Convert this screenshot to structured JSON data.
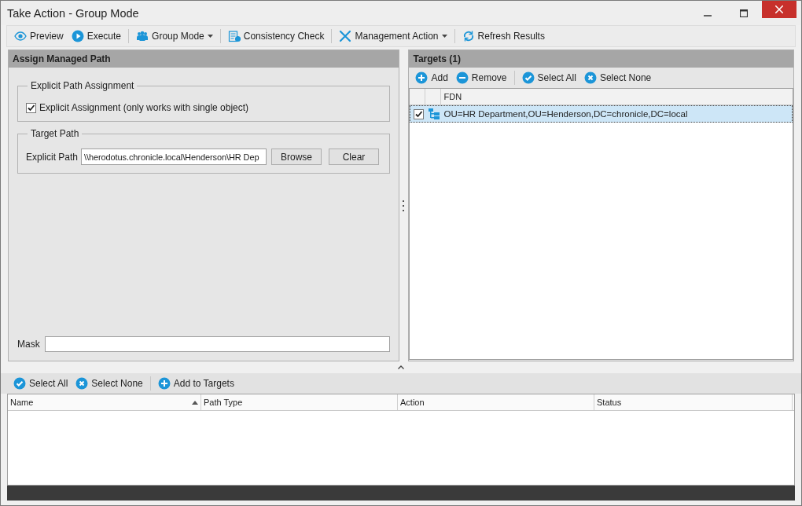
{
  "window": {
    "title": "Take Action  -  Group Mode"
  },
  "toolbar": [
    {
      "label": "Preview",
      "dropdown": false
    },
    {
      "label": "Execute",
      "dropdown": false
    },
    {
      "label": "Group Mode",
      "dropdown": true
    },
    {
      "label": "Consistency Check",
      "dropdown": false
    },
    {
      "label": "Management Action",
      "dropdown": true
    },
    {
      "label": "Refresh Results",
      "dropdown": false
    }
  ],
  "assign_panel": {
    "title": "Assign Managed Path",
    "explicit_group": {
      "title": "Explicit Path Assignment",
      "checkbox": {
        "label": "Explicit Assignment (only works with single object)",
        "checked": true
      }
    },
    "target_group": {
      "title": "Target Path",
      "field_label": "Explicit Path",
      "value": "\\\\herodotus.chronicle.local\\Henderson\\HR Dep",
      "buttons": [
        "Browse",
        "Clear"
      ]
    },
    "mask": {
      "label": "Mask"
    }
  },
  "targets": {
    "title": "Targets  (1)",
    "toolbar": [
      "Add",
      "Remove",
      "Select All",
      "Select None"
    ],
    "columns": [
      "FDN"
    ],
    "rows": [
      {
        "fdn": "OU=HR Department,OU=Henderson,DC=chronicle,DC=local",
        "checked": true,
        "selected": true
      }
    ]
  },
  "results": {
    "toolbar": [
      "Select All",
      "Select None",
      "Add to Targets"
    ],
    "columns": [
      {
        "label": "Name",
        "sorted": true
      },
      {
        "label": "Path Type",
        "sorted": false
      },
      {
        "label": "Action",
        "sorted": false
      },
      {
        "label": "Status",
        "sorted": false
      }
    ]
  }
}
